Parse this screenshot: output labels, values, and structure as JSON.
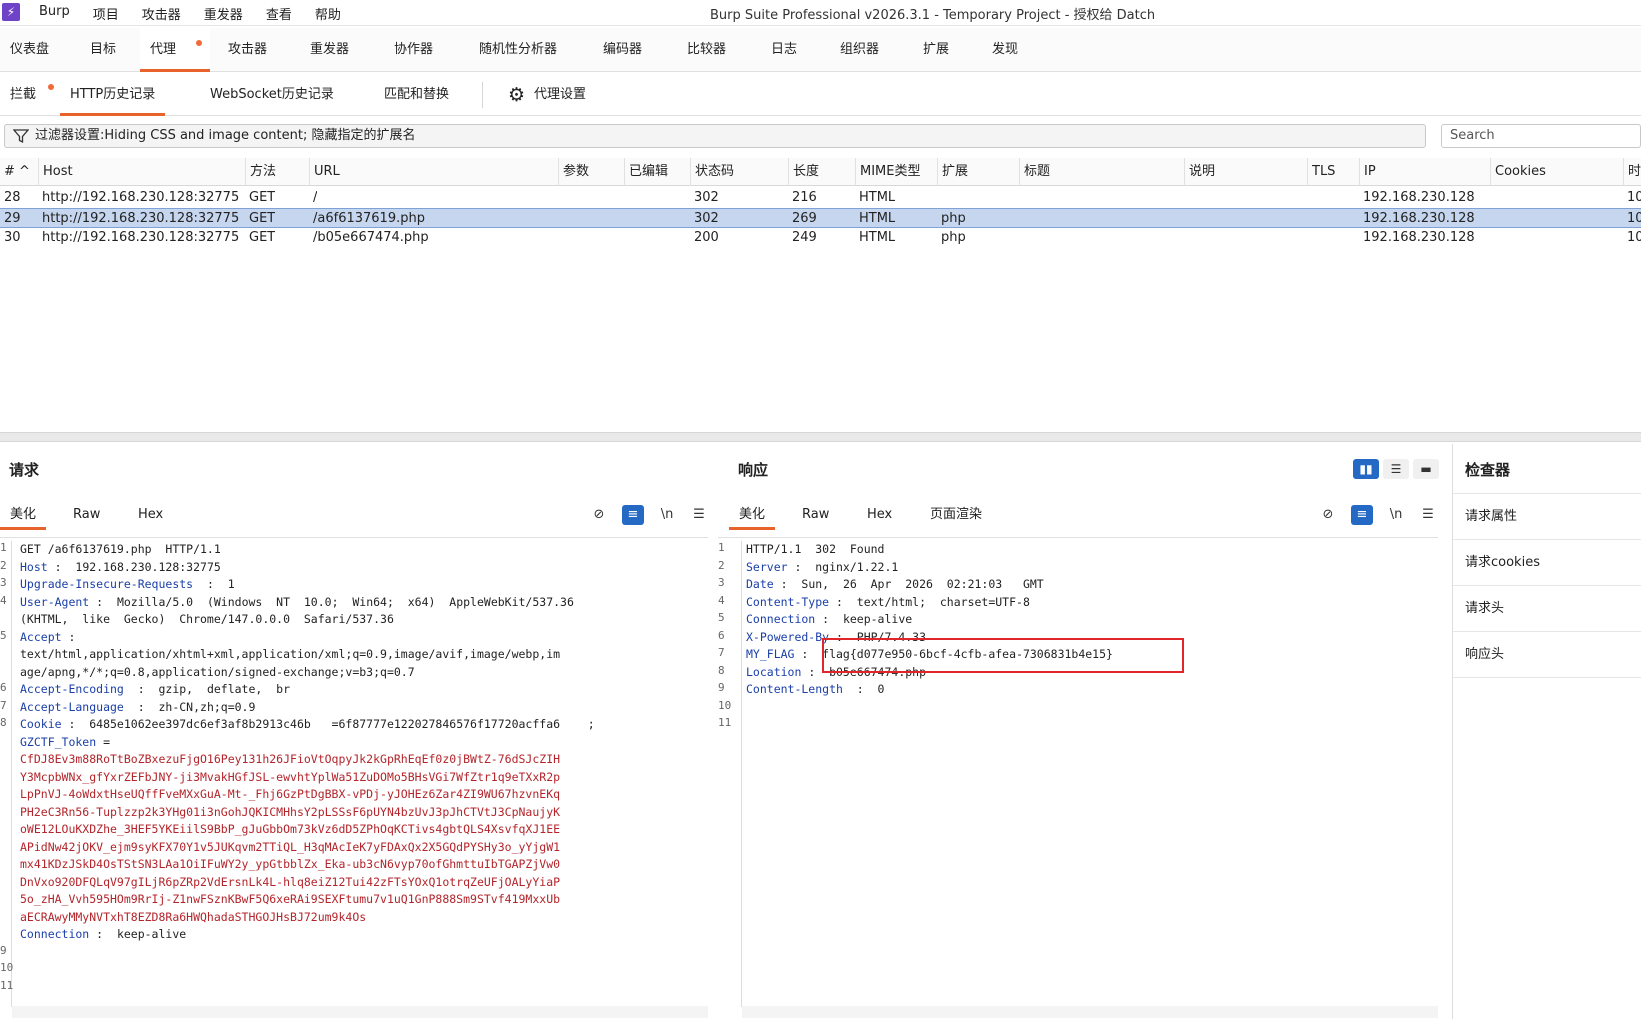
{
  "app": {
    "logo": "⚡",
    "title": "Burp Suite Professional v2026.3.1 - Temporary Project - 授权给 Datch"
  },
  "menu": [
    "Burp",
    "项目",
    "攻击器",
    "重发器",
    "查看",
    "帮助"
  ],
  "main_tabs": [
    "仪表盘",
    "目标",
    "代理",
    "攻击器",
    "重发器",
    "协作器",
    "随机性分析器",
    "编码器",
    "比较器",
    "日志",
    "组织器",
    "扩展",
    "发现"
  ],
  "sub_tabs": [
    "拦截",
    "HTTP历史记录",
    "WebSocket历史记录",
    "匹配和替换",
    "代理设置"
  ],
  "filter": {
    "text": "过滤器设置:Hiding CSS and image content; 隐藏指定的扩展名"
  },
  "search": {
    "placeholder": "Search"
  },
  "table": {
    "headers": [
      "#",
      "Host",
      "方法",
      "URL",
      "参数",
      "已编辑",
      "状态码",
      "长度",
      "MIME类型",
      "扩展",
      "标题",
      "说明",
      "TLS",
      "IP",
      "Cookies",
      "时"
    ],
    "sort_indicator": "^",
    "rows": [
      {
        "num": "28",
        "host": "http://192.168.230.128:32775",
        "method": "GET",
        "url": "/",
        "status": "302",
        "length": "216",
        "mime": "HTML",
        "ext": "",
        "ip": "192.168.230.128",
        "time": "10"
      },
      {
        "num": "29",
        "host": "http://192.168.230.128:32775",
        "method": "GET",
        "url": "/a6f6137619.php",
        "status": "302",
        "length": "269",
        "mime": "HTML",
        "ext": "php",
        "ip": "192.168.230.128",
        "time": "10"
      },
      {
        "num": "30",
        "host": "http://192.168.230.128:32775",
        "method": "GET",
        "url": "/b05e667474.php",
        "status": "200",
        "length": "249",
        "mime": "HTML",
        "ext": "php",
        "ip": "192.168.230.128",
        "time": "10"
      }
    ]
  },
  "request": {
    "title": "请求",
    "tabs": [
      "美化",
      "Raw",
      "Hex"
    ],
    "line_numbers": [
      "1",
      "2",
      "3",
      "4",
      "",
      "5",
      "",
      "",
      "6",
      "7",
      "8",
      "",
      "",
      "",
      "",
      "",
      "",
      "",
      "",
      "",
      "",
      "",
      "",
      "9",
      "10",
      "11"
    ],
    "lines": [
      {
        "k": "",
        "v": "GET /a6f6137619.php  HTTP/1.1"
      },
      {
        "k": "Host",
        "v": " :  192.168.230.128:32775"
      },
      {
        "k": "Upgrade-Insecure-Requests",
        "v": "  :  1"
      },
      {
        "k": "User-Agent",
        "v": " :  Mozilla/5.0  (Windows  NT  10.0;  Win64;  x64)  AppleWebKit/537.36"
      },
      {
        "k": "",
        "v": "(KHTML,  like  Gecko)  Chrome/147.0.0.0  Safari/537.36"
      },
      {
        "k": "Accept",
        "v": " :"
      },
      {
        "k": "",
        "v": "text/html,application/xhtml+xml,application/xml;q=0.9,image/avif,image/webp,im"
      },
      {
        "k": "",
        "v": "age/apng,*/*;q=0.8,application/signed-exchange;v=b3;q=0.7"
      },
      {
        "k": "Accept-Encoding",
        "v": "  :  gzip,  deflate,  br"
      },
      {
        "k": "Accept-Language",
        "v": "  :  zh-CN,zh;q=0.9"
      },
      {
        "k": "Cookie",
        "v": " :  6485e1062ee397dc6ef3af8b2913c46b   =6f87777e122027846576f17720acffa6    ;"
      },
      {
        "k": "GZCTF_Token",
        "v": " ="
      },
      {
        "k": "",
        "r": "CfDJ8Ev3m88RoTtBoZBxezuFjgO16Pey131h26JFioVtOqpyJk2kGpRhEqEf0z0jBWtZ-76dSJcZIH"
      },
      {
        "k": "",
        "r": "Y3McpbWNx_gfYxrZEFbJNY-ji3MvakHGfJSL-ewvhtYplWa51ZuDOMo5BHsVGi7WfZtr1q9eTXxR2p"
      },
      {
        "k": "",
        "r": "LpPnVJ-4oWdxtHseUQffFveMXxGuA-Mt-_Fhj6GzPtDgBBX-vPDj-yJOHEz6Zar4ZI9WU67hzvnEKq"
      },
      {
        "k": "",
        "r": "PH2eC3Rn56-Tuplzzp2k3YHg01i3nGohJQKICMHhsY2pLSSsF6pUYN4bzUvJ3pJhCTVtJ3CpNaujyK"
      },
      {
        "k": "",
        "r": "oWE12LOuKXDZhe_3HEF5YKEiilS9BbP_gJuGbbOm73kVz6dD5ZPhOqKCTivs4gbtQLS4XsvfqXJ1EE"
      },
      {
        "k": "",
        "r": "APidNw42jOKV_ejm9syKFX70Y1v5JUKqvm2TTiQL_H3qMAcIeK7yFDAxQx2X5GQdPYSHy3o_yYjgW1"
      },
      {
        "k": "",
        "r": "mx41KDzJSkD4OsTStSN3LAa1OiIFuWY2y_ypGtbblZx_Eka-ub3cN6vyp70ofGhmttuIbTGAPZjVw0"
      },
      {
        "k": "",
        "r": "DnVxo920DFQLqV97gILjR6pZRp2VdErsnLk4L-hlq8eiZ12Tui42zFTsYOxQ1otrqZeUFjOALyYiaP"
      },
      {
        "k": "",
        "r": "5o_zHA_Vvh595HOm9RrIj-Z1nwFSznKBwF5Q6xeRAi9SEXFtumu7v1uQ1GnP888Sm9STvf419MxxUb"
      },
      {
        "k": "",
        "r": "aECRAwyMMyNVTxhT8EZD8Ra6HWQhadaSTHGOJHsBJ72um9k4Os"
      },
      {
        "k": "Connection",
        "v": " :  keep-alive"
      },
      {
        "k": "",
        "v": ""
      },
      {
        "k": "",
        "v": ""
      }
    ]
  },
  "response": {
    "title": "响应",
    "tabs": [
      "美化",
      "Raw",
      "Hex",
      "页面渲染"
    ],
    "line_numbers": [
      "1",
      "2",
      "3",
      "4",
      "5",
      "6",
      "7",
      "8",
      "9",
      "10",
      "11"
    ],
    "lines": [
      {
        "k": "",
        "v": "HTTP/1.1  302  Found"
      },
      {
        "k": "Server",
        "v": " :  nginx/1.22.1"
      },
      {
        "k": "Date",
        "v": " :  Sun,  26  Apr  2026  02:21:03   GMT"
      },
      {
        "k": "Content-Type",
        "v": " :  text/html;  charset=UTF-8"
      },
      {
        "k": "Connection",
        "v": " :  keep-alive"
      },
      {
        "k": "X-Powered-By",
        "v": " :  PHP/7.4.33"
      },
      {
        "k": "MY_FLAG",
        "v": " :  flag{d077e950-6bcf-4cfb-afea-7306831b4e15}"
      },
      {
        "k": "Location",
        "v": " :  b05e667474.php"
      },
      {
        "k": "Content-Length",
        "v": "  :  0"
      },
      {
        "k": "",
        "v": ""
      },
      {
        "k": "",
        "v": ""
      }
    ]
  },
  "inspector": {
    "title": "检查器",
    "items": [
      "请求属性",
      "请求cookies",
      "请求头",
      "响应头"
    ]
  },
  "colors": {
    "accent": "#e8632b",
    "selected_row": "#c5d6ee",
    "header_key": "#1a3fa8",
    "token_value": "#b3252b",
    "highlight_box": "#e0262b",
    "toggle_on": "#2469c4"
  }
}
